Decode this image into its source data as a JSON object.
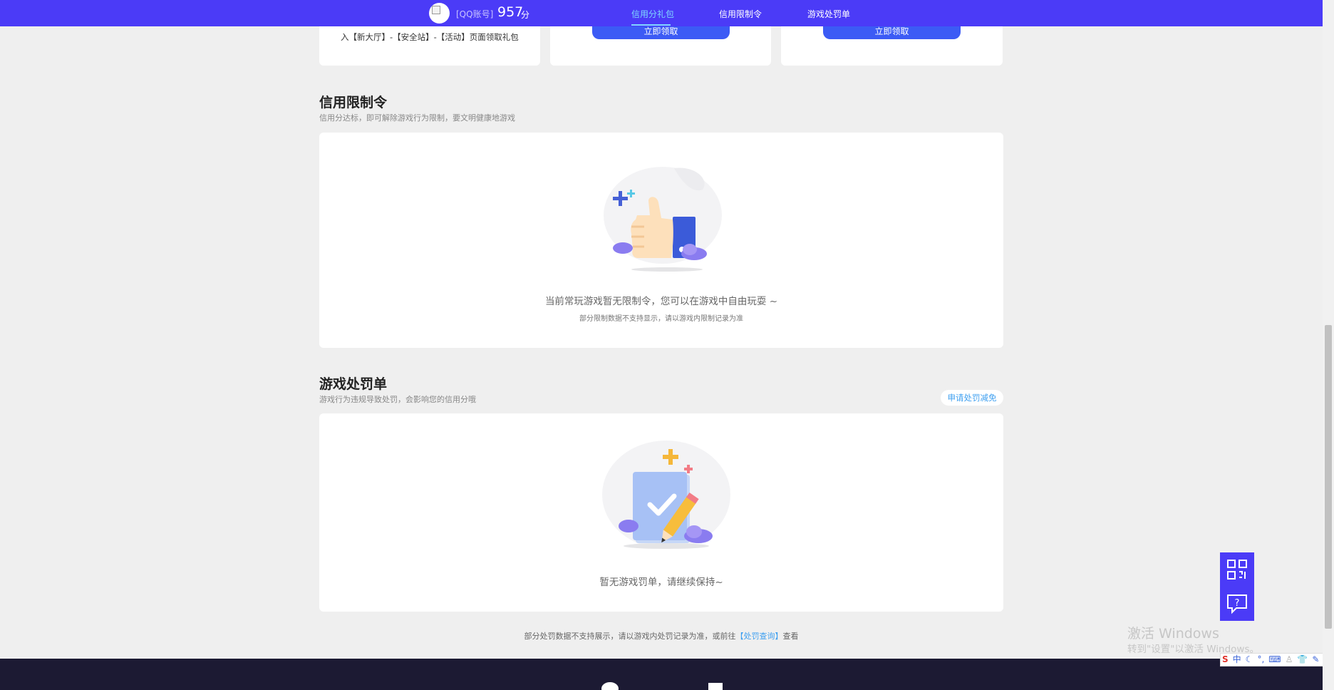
{
  "topbar": {
    "account_label": "[QQ账号]",
    "score": "957",
    "score_unit": "分",
    "tabs": [
      {
        "label": "信用分礼包",
        "active": true
      },
      {
        "label": "信用限制令",
        "active": false
      },
      {
        "label": "游戏处罚单",
        "active": false
      }
    ]
  },
  "gift_cards": {
    "card1_text": "入【新大厅】-【安全站】-【活动】页面领取礼包",
    "claim_label": "立即领取"
  },
  "restriction": {
    "title": "信用限制令",
    "subtitle": "信用分达标，即可解除游戏行为限制，要文明健康地游戏",
    "empty_main": "当前常玩游戏暂无限制令，您可以在游戏中自由玩耍 ~",
    "empty_sub": "部分限制数据不支持显示，请以游戏内限制记录为准"
  },
  "penalty": {
    "title": "游戏处罚单",
    "subtitle": "游戏行为违规导致处罚，会影响您的信用分哦",
    "appeal_button": "申请处罚减免",
    "empty_main": "暂无游戏罚单，请继续保持~"
  },
  "footer_note": {
    "before": "部分处罚数据不支持展示，请以游戏内处罚记录为准，或前往",
    "link": "【处罚查询】",
    "after": "查看"
  },
  "watermark": {
    "line1": "激活 Windows",
    "line2": "转到\"设置\"以激活 Windows。"
  },
  "ime": {
    "mode": "中"
  },
  "colors": {
    "nav_bg": "#4b3bf7",
    "active_tab": "#7fd8ff",
    "claim_btn": "#3c5bf5",
    "link": "#3fa0f0"
  }
}
